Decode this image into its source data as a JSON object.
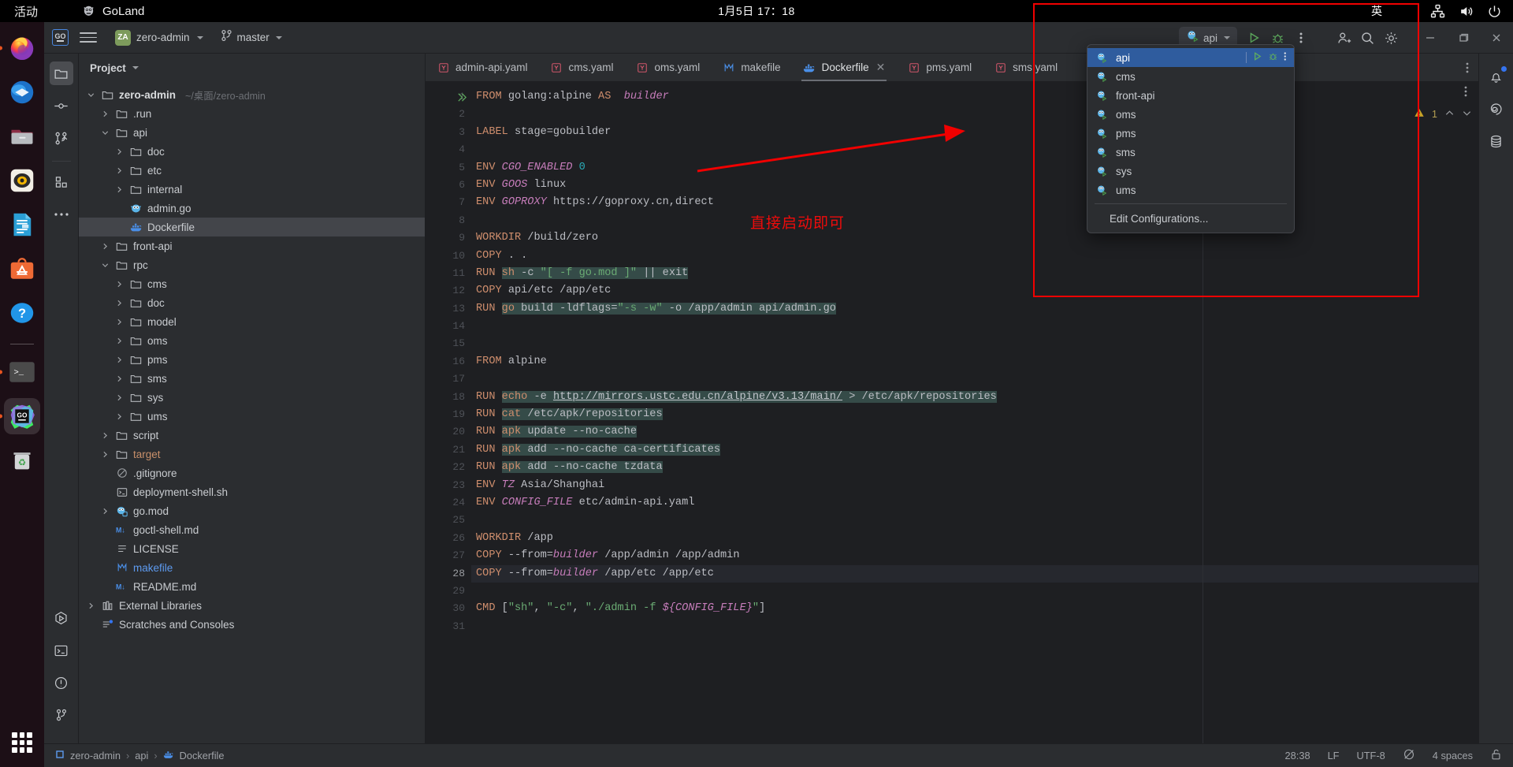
{
  "desktop": {
    "activities_label": "活动",
    "app_name": "GoLand",
    "clock": "1月5日 17：18",
    "ime_label": "英",
    "tray_icons": [
      "network-icon",
      "volume-icon",
      "power-icon"
    ],
    "dock_items": [
      {
        "name": "firefox-icon",
        "running": true
      },
      {
        "name": "thunderbird-icon",
        "running": false
      },
      {
        "name": "files-icon",
        "running": false
      },
      {
        "name": "rhythmbox-icon",
        "running": false
      },
      {
        "name": "libreoffice-writer-icon",
        "running": false
      },
      {
        "name": "ubuntu-software-icon",
        "running": false
      },
      {
        "name": "help-icon",
        "running": false
      },
      {
        "name": "terminal-icon",
        "running": true
      },
      {
        "name": "goland-icon",
        "running": true,
        "active": true
      },
      {
        "name": "trash-icon",
        "running": false
      }
    ],
    "app_grid": "show-applications-icon"
  },
  "toolbar": {
    "logo": "goland-logo-icon",
    "menu": "main-menu-hamburger-icon",
    "project_initials": "ZA",
    "project_name": "zero-admin",
    "branch_icon": "vcs-branch-icon",
    "branch_name": "master",
    "run_config_name": "api",
    "run_config_icon": "go-gopher-run-icon",
    "run_button": "run-icon",
    "debug_button": "debug-icon",
    "more_button": "more-vertical-icon",
    "actions": [
      "add-user-icon",
      "search-icon",
      "settings-gear-icon"
    ],
    "window_controls": [
      "minimize-icon",
      "maximize-icon",
      "close-icon"
    ]
  },
  "left_strip": {
    "top": [
      "project-tool-icon",
      "commit-tool-icon",
      "pull-requests-tool-icon",
      "structure-tool-icon",
      "more-tool-icon"
    ],
    "bottom": [
      "run-tool-icon",
      "terminal-tool-icon",
      "problems-tool-icon",
      "git-tool-icon"
    ]
  },
  "right_strip": {
    "icons": [
      "notifications-bell-icon",
      "ai-assistant-icon",
      "database-tool-icon"
    ]
  },
  "project_panel": {
    "title": "Project",
    "tree": [
      {
        "label": "zero-admin",
        "sub": "~/桌面/zero-admin",
        "indent": 0,
        "arrow": "down",
        "icon": "folder-icon",
        "bold": true
      },
      {
        "label": ".run",
        "indent": 1,
        "arrow": "right",
        "icon": "folder-icon"
      },
      {
        "label": "api",
        "indent": 1,
        "arrow": "down",
        "icon": "folder-icon"
      },
      {
        "label": "doc",
        "indent": 2,
        "arrow": "right",
        "icon": "folder-icon"
      },
      {
        "label": "etc",
        "indent": 2,
        "arrow": "right",
        "icon": "folder-icon"
      },
      {
        "label": "internal",
        "indent": 2,
        "arrow": "right",
        "icon": "folder-icon"
      },
      {
        "label": "admin.go",
        "indent": 2,
        "arrow": "none",
        "icon": "go-file-icon"
      },
      {
        "label": "Dockerfile",
        "indent": 2,
        "arrow": "none",
        "icon": "docker-icon",
        "selected": true
      },
      {
        "label": "front-api",
        "indent": 1,
        "arrow": "right",
        "icon": "folder-icon"
      },
      {
        "label": "rpc",
        "indent": 1,
        "arrow": "down",
        "icon": "folder-icon"
      },
      {
        "label": "cms",
        "indent": 2,
        "arrow": "right",
        "icon": "folder-icon"
      },
      {
        "label": "doc",
        "indent": 2,
        "arrow": "right",
        "icon": "folder-icon"
      },
      {
        "label": "model",
        "indent": 2,
        "arrow": "right",
        "icon": "folder-icon"
      },
      {
        "label": "oms",
        "indent": 2,
        "arrow": "right",
        "icon": "folder-icon"
      },
      {
        "label": "pms",
        "indent": 2,
        "arrow": "right",
        "icon": "folder-icon"
      },
      {
        "label": "sms",
        "indent": 2,
        "arrow": "right",
        "icon": "folder-icon"
      },
      {
        "label": "sys",
        "indent": 2,
        "arrow": "right",
        "icon": "folder-icon"
      },
      {
        "label": "ums",
        "indent": 2,
        "arrow": "right",
        "icon": "folder-icon"
      },
      {
        "label": "script",
        "indent": 1,
        "arrow": "right",
        "icon": "folder-icon"
      },
      {
        "label": "target",
        "indent": 1,
        "arrow": "right",
        "icon": "folder-icon",
        "color": "orange"
      },
      {
        "label": ".gitignore",
        "indent": 1,
        "arrow": "none",
        "icon": "ignored-file-icon"
      },
      {
        "label": "deployment-shell.sh",
        "indent": 1,
        "arrow": "none",
        "icon": "shell-script-icon"
      },
      {
        "label": "go.mod",
        "indent": 1,
        "arrow": "right",
        "icon": "go-mod-icon"
      },
      {
        "label": "goctl-shell.md",
        "indent": 1,
        "arrow": "none",
        "icon": "markdown-icon"
      },
      {
        "label": "LICENSE",
        "indent": 1,
        "arrow": "none",
        "icon": "text-file-icon"
      },
      {
        "label": "makefile",
        "indent": 1,
        "arrow": "none",
        "icon": "makefile-icon",
        "color": "blue"
      },
      {
        "label": "README.md",
        "indent": 1,
        "arrow": "none",
        "icon": "markdown-icon"
      },
      {
        "label": "External Libraries",
        "indent": 0,
        "arrow": "right",
        "icon": "libraries-icon"
      },
      {
        "label": "Scratches and Consoles",
        "indent": 0,
        "arrow": "none",
        "icon": "scratches-icon"
      }
    ]
  },
  "editor": {
    "tabs": [
      {
        "label": "admin-api.yaml",
        "icon": "yaml-file-icon",
        "active": false
      },
      {
        "label": "cms.yaml",
        "icon": "yaml-file-icon",
        "active": false
      },
      {
        "label": "oms.yaml",
        "icon": "yaml-file-icon",
        "active": false
      },
      {
        "label": "makefile",
        "icon": "makefile-icon",
        "active": false
      },
      {
        "label": "Dockerfile",
        "icon": "docker-icon",
        "active": true,
        "closable": true
      },
      {
        "label": "pms.yaml",
        "icon": "yaml-file-icon",
        "active": false
      },
      {
        "label": "sms.yaml",
        "icon": "yaml-file-icon",
        "active": false
      }
    ],
    "tabs_more": "more-vertical-icon",
    "first_line_number": 1,
    "last_line_number": 31,
    "current_line": 28,
    "inspection_warnings": "1",
    "inspection_icon": "warning-triangle-icon",
    "inspection_up": "chevron-up-icon",
    "inspection_down": "chevron-down-icon",
    "inspection_more": "more-vertical-icon",
    "run_line_marker": "run-line-icon",
    "lines": [
      {
        "n": 1,
        "text": "FROM golang:alpine AS builder"
      },
      {
        "n": 2,
        "text": ""
      },
      {
        "n": 3,
        "text": "LABEL stage=gobuilder"
      },
      {
        "n": 4,
        "text": ""
      },
      {
        "n": 5,
        "text": "ENV CGO_ENABLED 0"
      },
      {
        "n": 6,
        "text": "ENV GOOS linux"
      },
      {
        "n": 7,
        "text": "ENV GOPROXY https://goproxy.cn,direct"
      },
      {
        "n": 8,
        "text": ""
      },
      {
        "n": 9,
        "text": "WORKDIR /build/zero"
      },
      {
        "n": 10,
        "text": "COPY . ."
      },
      {
        "n": 11,
        "text": "RUN sh -c \"[ -f go.mod ]\" || exit"
      },
      {
        "n": 12,
        "text": "COPY api/etc /app/etc"
      },
      {
        "n": 13,
        "text": "RUN go build -ldflags=\"-s -w\" -o /app/admin api/admin.go"
      },
      {
        "n": 14,
        "text": ""
      },
      {
        "n": 15,
        "text": ""
      },
      {
        "n": 16,
        "text": "FROM alpine"
      },
      {
        "n": 17,
        "text": ""
      },
      {
        "n": 18,
        "text": "RUN echo -e http://mirrors.ustc.edu.cn/alpine/v3.13/main/ > /etc/apk/repositories"
      },
      {
        "n": 19,
        "text": "RUN cat /etc/apk/repositories"
      },
      {
        "n": 20,
        "text": "RUN apk update --no-cache"
      },
      {
        "n": 21,
        "text": "RUN apk add --no-cache ca-certificates"
      },
      {
        "n": 22,
        "text": "RUN apk add --no-cache tzdata"
      },
      {
        "n": 23,
        "text": "ENV TZ Asia/Shanghai"
      },
      {
        "n": 24,
        "text": "ENV CONFIG_FILE etc/admin-api.yaml"
      },
      {
        "n": 25,
        "text": ""
      },
      {
        "n": 26,
        "text": "WORKDIR /app"
      },
      {
        "n": 27,
        "text": "COPY --from=builder /app/admin /app/admin"
      },
      {
        "n": 28,
        "text": "COPY --from=builder /app/etc /app/etc"
      },
      {
        "n": 29,
        "text": ""
      },
      {
        "n": 30,
        "text": "CMD [\"sh\", \"-c\", \"./admin -f ${CONFIG_FILE}\"]"
      },
      {
        "n": 31,
        "text": ""
      }
    ]
  },
  "run_config_popup": {
    "items": [
      {
        "label": "api",
        "icon": "go-gopher-run-icon",
        "selected": true,
        "actions": [
          "run-icon",
          "debug-icon",
          "more-vertical-icon"
        ]
      },
      {
        "label": "cms",
        "icon": "go-gopher-run-icon"
      },
      {
        "label": "front-api",
        "icon": "go-gopher-run-icon"
      },
      {
        "label": "oms",
        "icon": "go-gopher-run-icon"
      },
      {
        "label": "pms",
        "icon": "go-gopher-run-icon"
      },
      {
        "label": "sms",
        "icon": "go-gopher-run-icon"
      },
      {
        "label": "sys",
        "icon": "go-gopher-run-icon"
      },
      {
        "label": "ums",
        "icon": "go-gopher-run-icon"
      }
    ],
    "edit_label": "Edit Configurations..."
  },
  "annotation": {
    "note_text": "直接启动即可",
    "color": "#f10000",
    "box_label": "highlight-box",
    "arrow_label": "pointer-arrow"
  },
  "status_bar": {
    "breadcrumb": [
      {
        "label": "zero-admin",
        "icon": "project-icon"
      },
      {
        "label": "api"
      },
      {
        "label": "Dockerfile",
        "icon": "docker-icon"
      }
    ],
    "caret": "28:38",
    "line_separator": "LF",
    "encoding": "UTF-8",
    "inspections_icon": "inspections-off-icon",
    "indent": "4 spaces",
    "lock_icon": "unlocked-icon"
  }
}
